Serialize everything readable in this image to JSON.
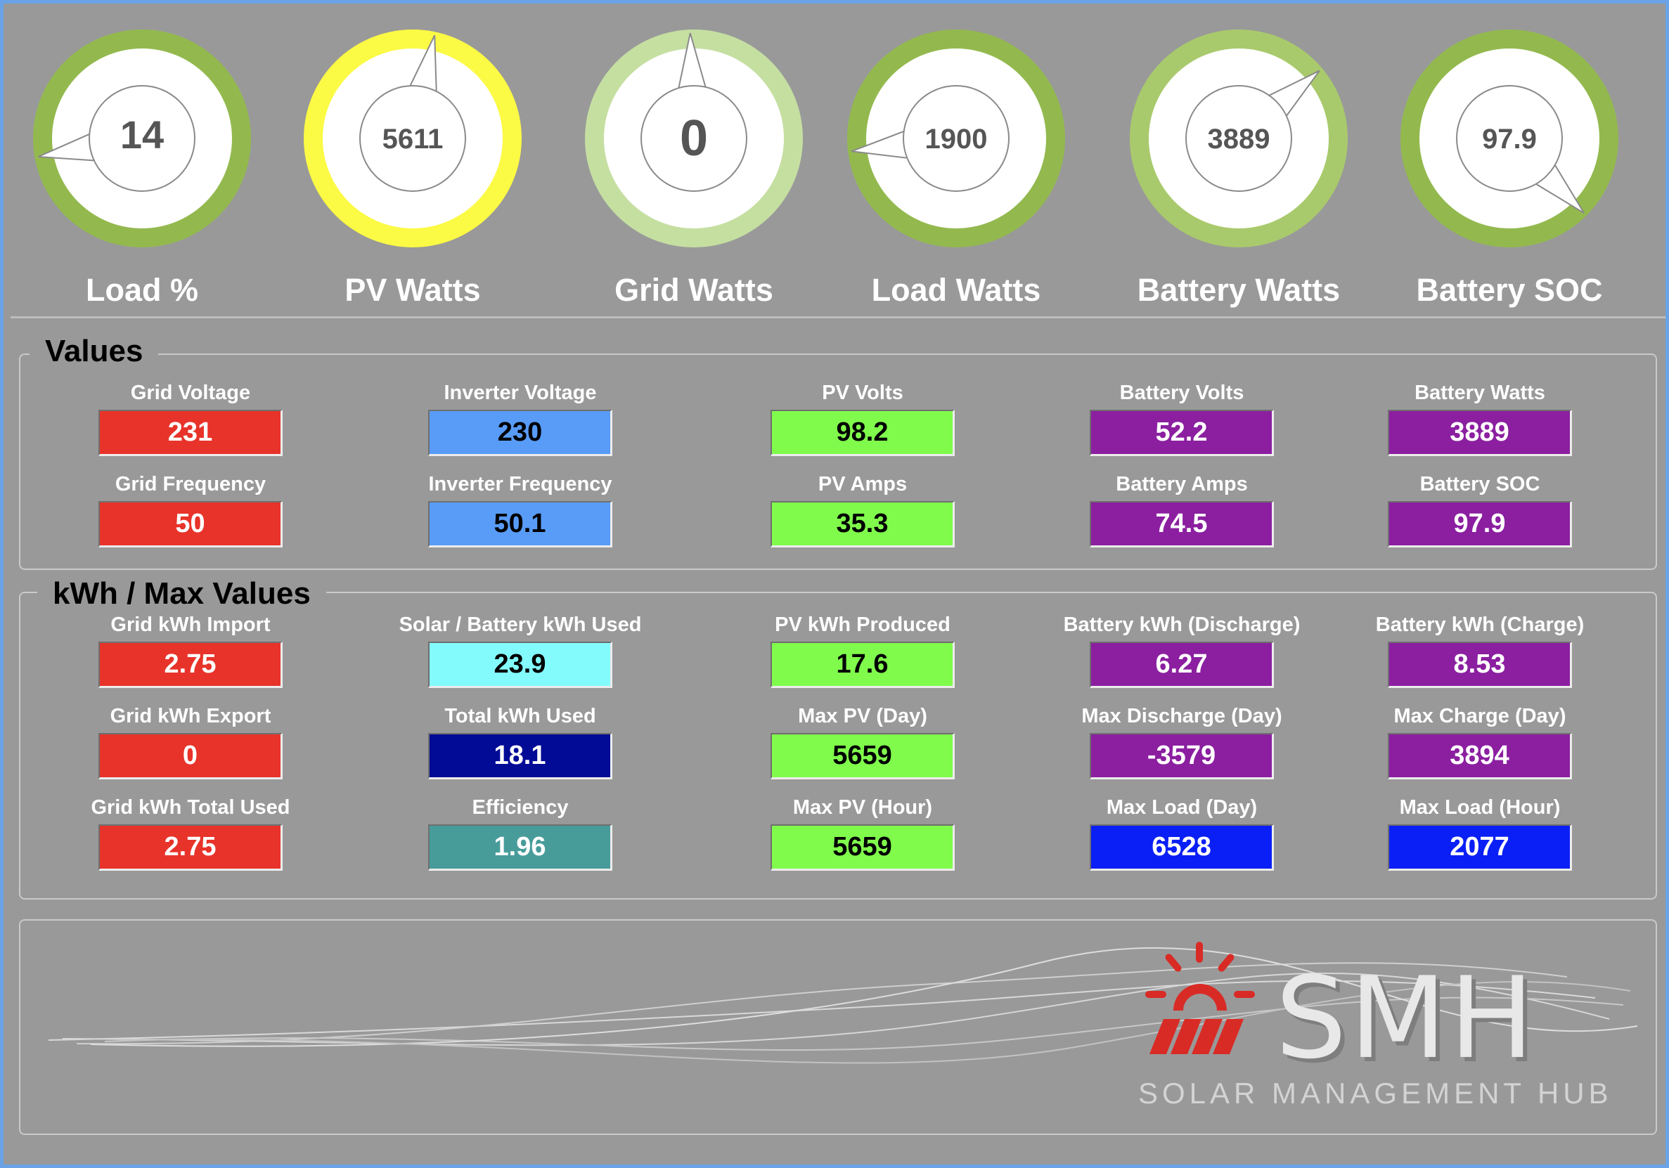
{
  "gauges": [
    {
      "label": "Load %",
      "value": "14",
      "level": 0.14,
      "ring_color": "#93b94e",
      "needle_deg": -100
    },
    {
      "label": "PV Watts",
      "value": "5611",
      "level": 0.56,
      "ring_color": "#fbfa45",
      "needle_deg": 12
    },
    {
      "label": "Grid Watts",
      "value": "0",
      "level": 0.0,
      "ring_color": "#c5dfa1",
      "needle_deg": -2
    },
    {
      "label": "Load Watts",
      "value": "1900",
      "level": 0.19,
      "ring_color": "#93b94e",
      "needle_deg": -97
    },
    {
      "label": "Battery Watts",
      "value": "3889",
      "level": 0.39,
      "ring_color": "#a9ca6c",
      "needle_deg": 50
    },
    {
      "label": "Battery SOC",
      "value": "97.9",
      "level": 0.979,
      "ring_color": "#93b94e",
      "needle_deg": 135
    }
  ],
  "values_section": {
    "title": "Values",
    "cells": [
      {
        "label": "Grid Voltage",
        "value": "231",
        "color": "red"
      },
      {
        "label": "Inverter Voltage",
        "value": "230",
        "color": "lblue"
      },
      {
        "label": "PV Volts",
        "value": "98.2",
        "color": "green"
      },
      {
        "label": "Battery Volts",
        "value": "52.2",
        "color": "purple"
      },
      {
        "label": "Battery Watts",
        "value": "3889",
        "color": "purple"
      },
      {
        "label": "Grid Frequency",
        "value": "50",
        "color": "red"
      },
      {
        "label": "Inverter Frequency",
        "value": "50.1",
        "color": "lblue"
      },
      {
        "label": "PV Amps",
        "value": "35.3",
        "color": "green"
      },
      {
        "label": "Battery Amps",
        "value": "74.5",
        "color": "purple"
      },
      {
        "label": "Battery SOC",
        "value": "97.9",
        "color": "purple"
      }
    ]
  },
  "kwh_section": {
    "title": "kWh / Max Values",
    "cells": [
      {
        "label": "Grid kWh Import",
        "value": "2.75",
        "color": "red"
      },
      {
        "label": "Solar / Battery kWh Used",
        "value": "23.9",
        "color": "cyan"
      },
      {
        "label": "PV kWh Produced",
        "value": "17.6",
        "color": "green"
      },
      {
        "label": "Battery kWh (Discharge)",
        "value": "6.27",
        "color": "purple"
      },
      {
        "label": "Battery kWh (Charge)",
        "value": "8.53",
        "color": "purple"
      },
      {
        "label": "Grid kWh Export",
        "value": "0",
        "color": "red"
      },
      {
        "label": "Total kWh Used",
        "value": "18.1",
        "color": "navy"
      },
      {
        "label": "Max PV (Day)",
        "value": "5659",
        "color": "green"
      },
      {
        "label": "Max Discharge (Day)",
        "value": "-3579",
        "color": "purple"
      },
      {
        "label": "Max Charge (Day)",
        "value": "3894",
        "color": "purple"
      },
      {
        "label": "Grid kWh Total Used",
        "value": "2.75",
        "color": "red"
      },
      {
        "label": "Efficiency",
        "value": "1.96",
        "color": "teal"
      },
      {
        "label": "Max PV (Hour)",
        "value": "5659",
        "color": "green"
      },
      {
        "label": "Max Load (Day)",
        "value": "6528",
        "color": "blue"
      },
      {
        "label": "Max Load (Hour)",
        "value": "2077",
        "color": "blue"
      }
    ]
  },
  "logo": {
    "letters": "SMH",
    "subtitle": "SOLAR MANAGEMENT HUB"
  },
  "colors": {
    "background": "#999999",
    "frame": "#6aa3e6",
    "logo_red": "#d92b25"
  }
}
